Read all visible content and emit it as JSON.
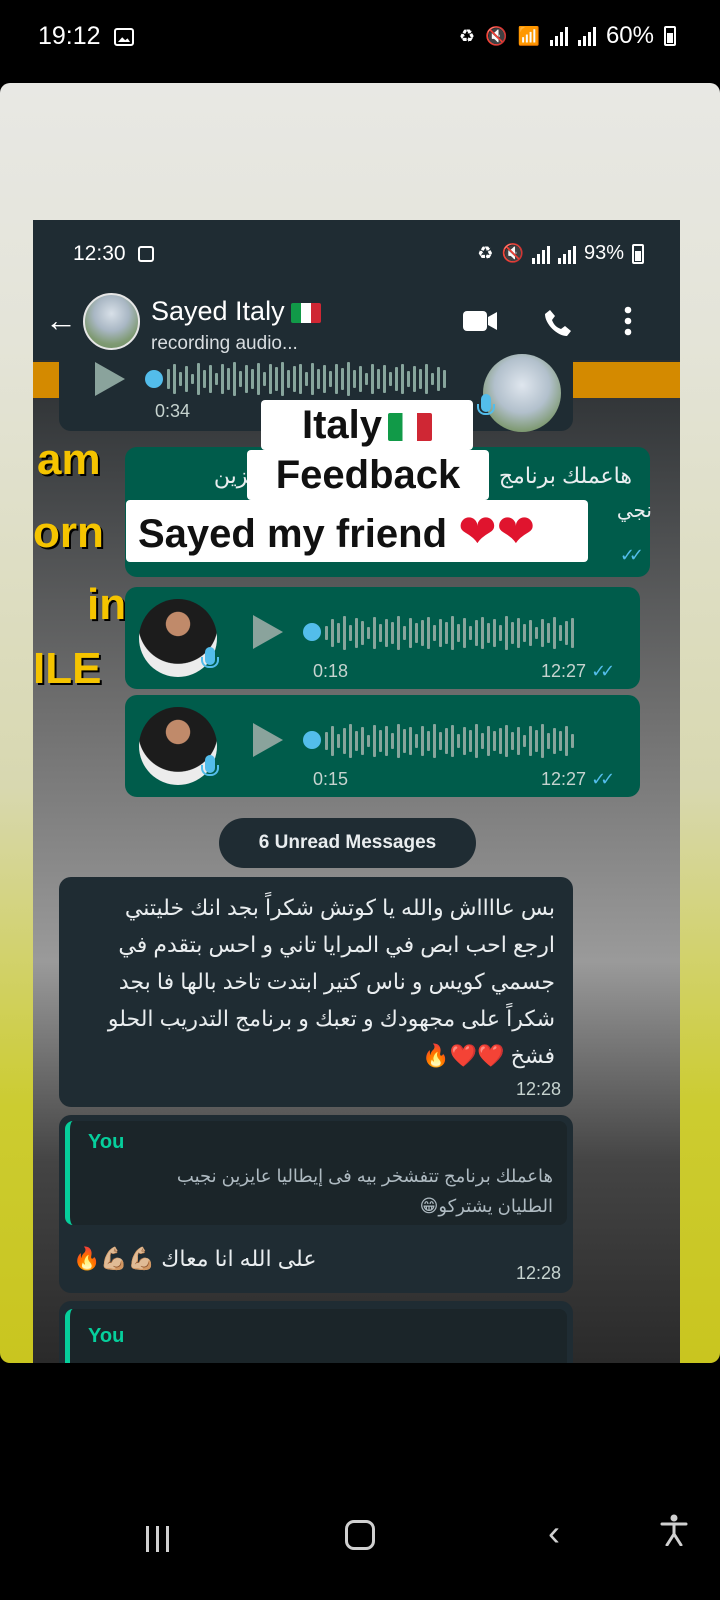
{
  "outer_status": {
    "time": "19:12",
    "battery": "60%"
  },
  "inner_status": {
    "time": "12:30",
    "battery": "93%"
  },
  "chat_header": {
    "name": "Sayed Italy",
    "status": "recording audio..."
  },
  "overlay": {
    "line1": "Italy",
    "line2": "Feedback",
    "line3": "Sayed my friend",
    "hearts": "❤❤"
  },
  "messages": {
    "top_voice": {
      "duration": "0:34"
    },
    "partial_text": {
      "line1": "هاعملك برنامج",
      "line1_end": "يزين",
      "line2": "نجي"
    },
    "voice1": {
      "duration": "0:18",
      "time": "12:27"
    },
    "voice2": {
      "duration": "0:15",
      "time": "12:27"
    },
    "unread": "6 Unread Messages",
    "incoming": {
      "lines": [
        "بس عااااش والله يا كوتش شكراً بجد انك خليتني",
        "ارجع احب ابص في المرايا تاني و احس بتقدم في",
        "جسمي كويس و ناس كتير ابتدت تاخد بالها فا بجد",
        "شكراً على مجهودك و تعبك و برنامج التدريب الحلو",
        "فشخ ❤️❤️🔥"
      ],
      "time": "12:28"
    },
    "reply": {
      "quote_author": "You",
      "quote_line1": "هاعملك برنامج تتفشخر بيه فى إيطاليا عايزين نجيب",
      "quote_line2": "الطليان  يشتركو😁",
      "text": "على الله انا معاك 💪🏼💪🏼🔥",
      "time": "12:28"
    },
    "next_quote_author": "You"
  }
}
